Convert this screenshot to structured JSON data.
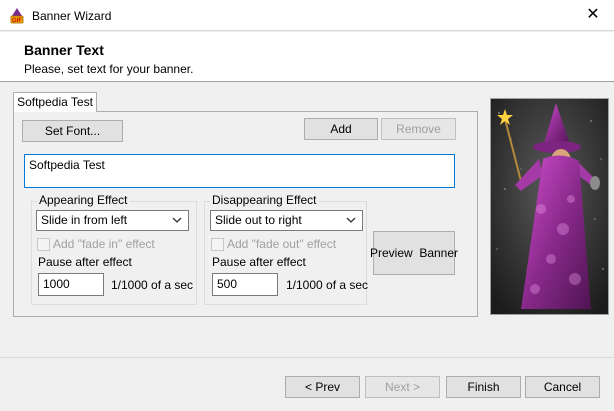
{
  "window": {
    "title": "Banner Wizard",
    "close_glyph": "✕"
  },
  "header": {
    "title": "Banner Text",
    "subtitle": "Please, set text for your banner."
  },
  "tabs": [
    {
      "label": "Softpedia Test",
      "selected": true
    }
  ],
  "toolbar": {
    "set_font_label": "Set Font...",
    "add_label": "Add",
    "remove_label": "Remove"
  },
  "banner_text": {
    "value": "Softpedia Test"
  },
  "appearing": {
    "group_label": "Appearing Effect",
    "effect_selected": "Slide in from left",
    "fade_label": "Add \"fade in\" effect",
    "fade_checked": false,
    "pause_label": "Pause after effect",
    "pause_value": "1000",
    "unit_label": "1/1000 of a sec"
  },
  "disappearing": {
    "group_label": "Disappearing Effect",
    "effect_selected": "Slide out to right",
    "fade_label": "Add \"fade out\" effect",
    "fade_checked": false,
    "pause_label": "Pause after effect",
    "pause_value": "500",
    "unit_label": "1/1000 of a sec"
  },
  "preview_label": "Preview  Banner",
  "footer": {
    "prev_label": "< Prev",
    "next_label": "Next >",
    "finish_label": "Finish",
    "cancel_label": "Cancel"
  },
  "icons": {
    "app": "gif-wizard-icon",
    "dropdown": "chevron-down-icon",
    "image": "wizard-illustration"
  },
  "colors": {
    "accent": "#0078d7",
    "robe": "#9b2f9c",
    "bg": "#f0f0f0"
  }
}
